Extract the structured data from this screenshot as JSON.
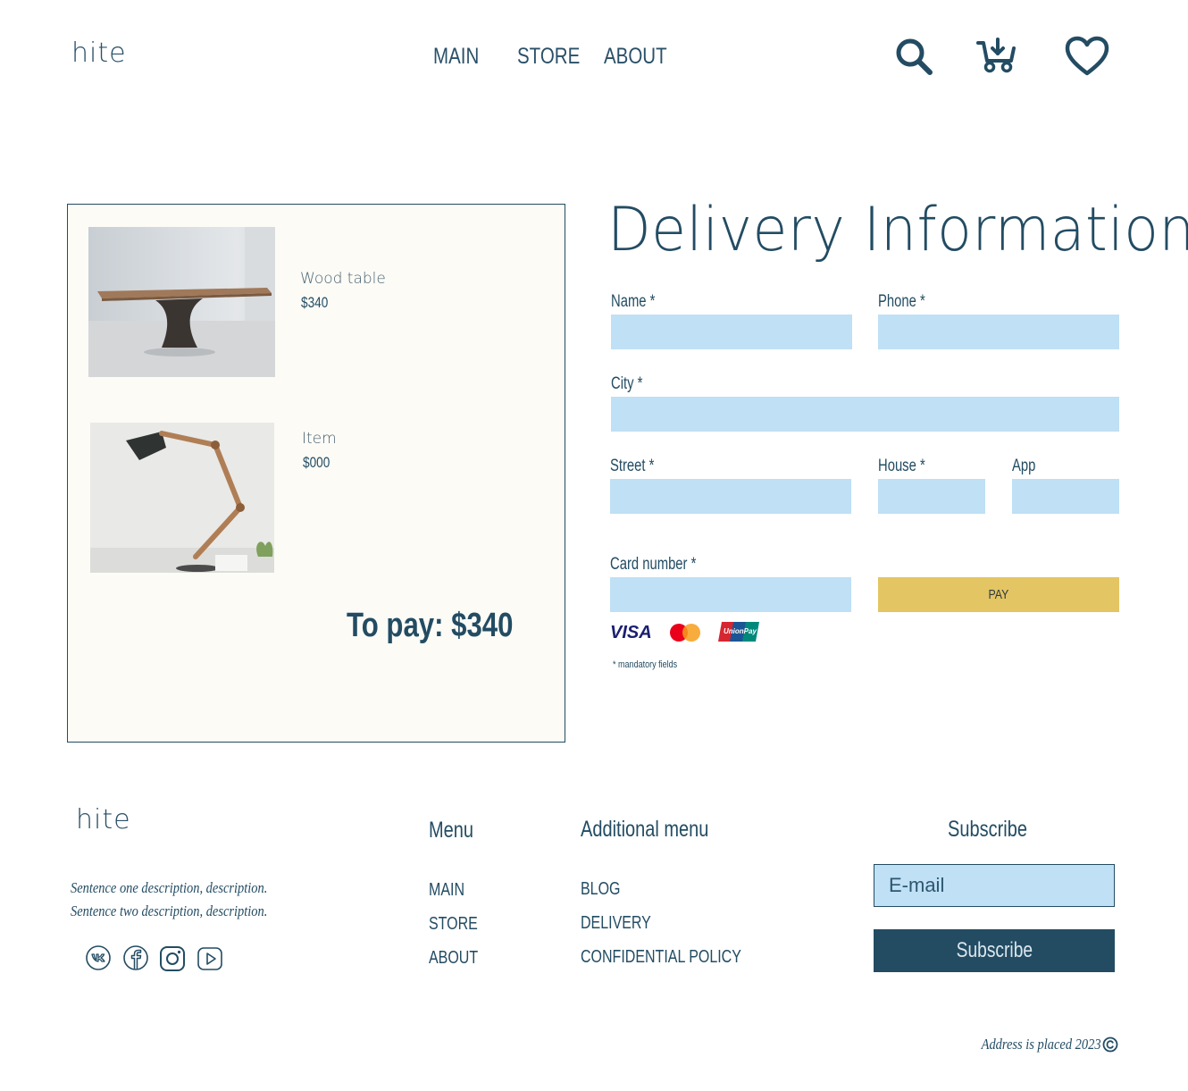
{
  "header": {
    "logo": "hite",
    "nav": [
      "MAIN",
      "STORE",
      "ABOUT"
    ]
  },
  "order": {
    "items": [
      {
        "name": "Wood table",
        "price": "$340",
        "image": "wood-table-photo"
      },
      {
        "name": "Item",
        "price": "$000",
        "image": "desk-lamp-photo"
      }
    ],
    "to_pay": "To pay: $340"
  },
  "form": {
    "title": "Delivery Information",
    "labels": {
      "name": "Name *",
      "phone": "Phone *",
      "city": "City *",
      "street": "Street *",
      "house": "House *",
      "app": "App",
      "card": "Card number *"
    },
    "pay_label": "PAY",
    "card_brands": [
      "VISA",
      "Mastercard",
      "UnionPay"
    ],
    "mandatory_note": "* mandatory fields"
  },
  "footer": {
    "logo": "hite",
    "description": [
      "Sentence one description, description.",
      "Sentence two description, description."
    ],
    "social": [
      "vk-icon",
      "facebook-icon",
      "instagram-icon",
      "youtube-icon"
    ],
    "menu_heading": "Menu",
    "menu": [
      "MAIN",
      "STORE",
      "ABOUT"
    ],
    "additional_heading": "Additional menu",
    "additional": [
      "BLOG",
      "DELIVERY",
      "CONFIDENTIAL POLICY"
    ],
    "subscribe_heading": "Subscribe",
    "email_placeholder": "E-mail",
    "subscribe_button": "Subscribe",
    "address": "Address is placed 2023"
  },
  "colors": {
    "primary": "#234c63",
    "input_bg": "#bfe0f5",
    "pay_button": "#e4c563",
    "order_bg": "#fcfbf6"
  }
}
